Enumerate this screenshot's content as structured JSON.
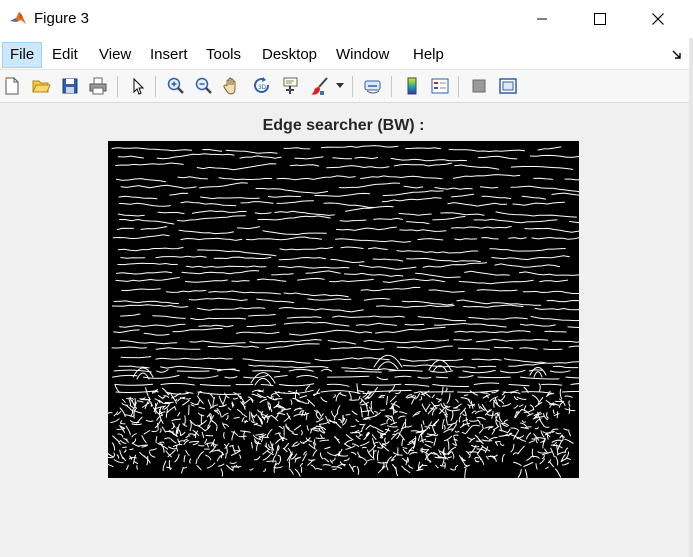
{
  "window": {
    "title": "Figure 3",
    "controls": [
      "minimize-icon",
      "maximize-icon",
      "close-icon"
    ]
  },
  "menubar": {
    "items": [
      {
        "label": "File",
        "active": true
      },
      {
        "label": "Edit"
      },
      {
        "label": "View"
      },
      {
        "label": "Insert"
      },
      {
        "label": "Tools"
      },
      {
        "label": "Desktop"
      },
      {
        "label": "Window"
      },
      {
        "label": "Help"
      }
    ]
  },
  "toolbar": {
    "buttons": [
      "new-figure-icon",
      "open-file-icon",
      "save-icon",
      "print-icon",
      "edit-plot-pointer-icon",
      "zoom-in-icon",
      "zoom-out-icon",
      "pan-hand-icon",
      "rotate-3d-icon",
      "data-cursor-icon",
      "brush-icon",
      "brush-dropdown-icon",
      "link-plot-icon",
      "insert-colorbar-icon",
      "insert-legend-icon",
      "hide-plot-tools-icon",
      "show-plot-tools-icon"
    ]
  },
  "figure": {
    "title": "Edge searcher (BW) :",
    "image": "binary edge-detection image: white edge lines on black background",
    "background_color": "#000000",
    "edge_color": "#ffffff"
  }
}
